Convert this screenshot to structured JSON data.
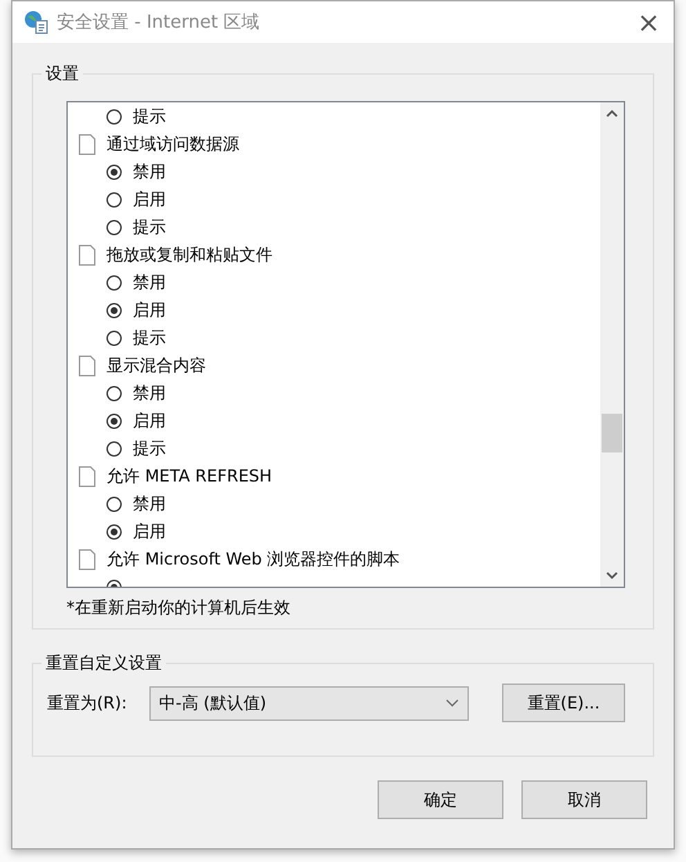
{
  "window": {
    "title": "安全设置 - Internet 区域",
    "close": "×"
  },
  "settings": {
    "legend": "设置",
    "items": [
      {
        "kind": "option",
        "label": "提示",
        "selected": false
      },
      {
        "kind": "group",
        "label": "通过域访问数据源",
        "children": [
          {
            "kind": "option",
            "label": "禁用",
            "selected": true
          },
          {
            "kind": "option",
            "label": "启用",
            "selected": false
          },
          {
            "kind": "option",
            "label": "提示",
            "selected": false
          }
        ]
      },
      {
        "kind": "group",
        "label": "拖放或复制和粘贴文件",
        "children": [
          {
            "kind": "option",
            "label": "禁用",
            "selected": false
          },
          {
            "kind": "option",
            "label": "启用",
            "selected": true
          },
          {
            "kind": "option",
            "label": "提示",
            "selected": false
          }
        ]
      },
      {
        "kind": "group",
        "label": "显示混合内容",
        "children": [
          {
            "kind": "option",
            "label": "禁用",
            "selected": false
          },
          {
            "kind": "option",
            "label": "启用",
            "selected": true
          },
          {
            "kind": "option",
            "label": "提示",
            "selected": false
          }
        ]
      },
      {
        "kind": "group",
        "label": "允许 META REFRESH",
        "children": [
          {
            "kind": "option",
            "label": "禁用",
            "selected": false
          },
          {
            "kind": "option",
            "label": "启用",
            "selected": true
          }
        ]
      },
      {
        "kind": "group",
        "label": "允许 Microsoft Web 浏览器控件的脚本",
        "children": [
          {
            "kind": "option",
            "selected": true
          }
        ]
      }
    ],
    "note": "*在重新启动你的计算机后生效"
  },
  "reset": {
    "legend": "重置自定义设置",
    "label": "重置为(R):",
    "value": "中-高 (默认值)",
    "button": "重置(E)..."
  },
  "buttons": [
    "确定",
    "取消"
  ]
}
